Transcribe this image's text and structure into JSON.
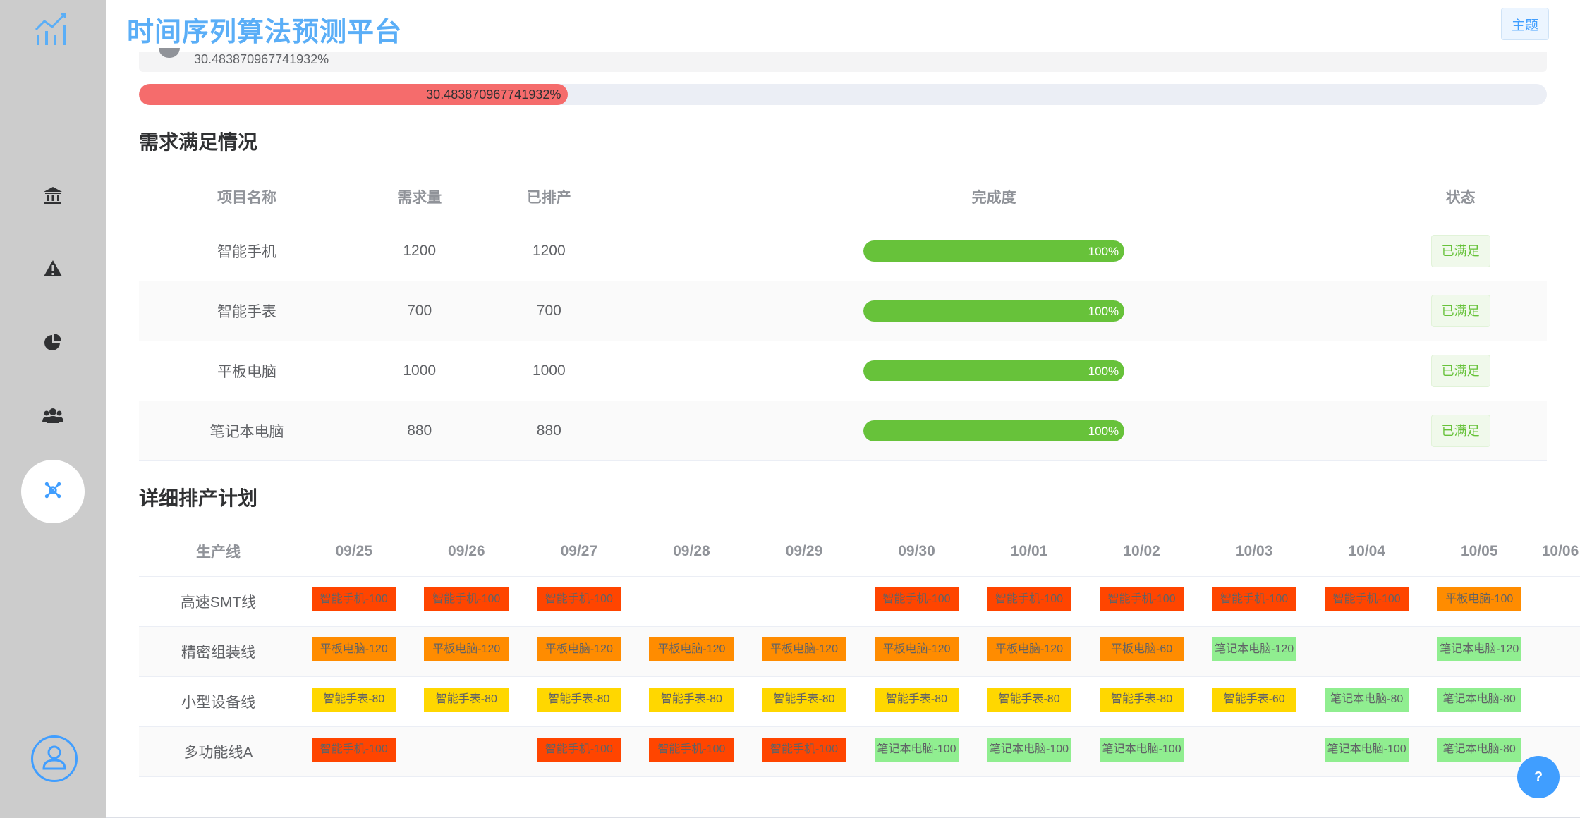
{
  "app": {
    "title": "时间序列算法预测平台",
    "theme_label": "主题"
  },
  "colors": {
    "accent": "#409eff",
    "title": "#5aaef7",
    "danger": "#f56c6c",
    "success": "#67c23a",
    "smartphone": "#ff4500",
    "tablet": "#ff8c00",
    "smartwatch": "#ffd700",
    "laptop": "#90ee90"
  },
  "sidebar": {
    "logo_icon": "chart-logo-icon",
    "items": [
      {
        "icon": "bank-icon"
      },
      {
        "icon": "warning-icon"
      },
      {
        "icon": "pie-chart-icon"
      },
      {
        "icon": "users-icon"
      },
      {
        "icon": "network-icon",
        "active": true
      }
    ],
    "avatar_icon": "user-icon"
  },
  "overall": {
    "info_text": "30.483870967741932%",
    "progress_label": "30.483870967741932%",
    "progress_fraction": 0.3048
  },
  "demand": {
    "title": "需求满足情况",
    "columns": [
      "项目名称",
      "需求量",
      "已排产",
      "完成度",
      "状态"
    ],
    "rows": [
      {
        "name": "智能手机",
        "demand": "1200",
        "scheduled": "1200",
        "completion_label": "100%",
        "completion": 1.0,
        "status": "已满足"
      },
      {
        "name": "智能手表",
        "demand": "700",
        "scheduled": "700",
        "completion_label": "100%",
        "completion": 1.0,
        "status": "已满足"
      },
      {
        "name": "平板电脑",
        "demand": "1000",
        "scheduled": "1000",
        "completion_label": "100%",
        "completion": 1.0,
        "status": "已满足"
      },
      {
        "name": "笔记本电脑",
        "demand": "880",
        "scheduled": "880",
        "completion_label": "100%",
        "completion": 1.0,
        "status": "已满足"
      }
    ]
  },
  "schedule": {
    "title": "详细排产计划",
    "line_header": "生产线",
    "dates": [
      "09/25",
      "09/26",
      "09/27",
      "09/28",
      "09/29",
      "09/30",
      "10/01",
      "10/02",
      "10/03",
      "10/04",
      "10/05",
      "10/06"
    ],
    "rows": [
      {
        "line": "高速SMT线",
        "cells": [
          {
            "text": "智能手机-100",
            "product": "smartphone"
          },
          {
            "text": "智能手机-100",
            "product": "smartphone"
          },
          {
            "text": "智能手机-100",
            "product": "smartphone"
          },
          null,
          null,
          {
            "text": "智能手机-100",
            "product": "smartphone"
          },
          {
            "text": "智能手机-100",
            "product": "smartphone"
          },
          {
            "text": "智能手机-100",
            "product": "smartphone"
          },
          {
            "text": "智能手机-100",
            "product": "smartphone"
          },
          {
            "text": "智能手机-100",
            "product": "smartphone"
          },
          {
            "text": "平板电脑-100",
            "product": "tablet"
          },
          null
        ]
      },
      {
        "line": "精密组装线",
        "cells": [
          {
            "text": "平板电脑-120",
            "product": "tablet"
          },
          {
            "text": "平板电脑-120",
            "product": "tablet"
          },
          {
            "text": "平板电脑-120",
            "product": "tablet"
          },
          {
            "text": "平板电脑-120",
            "product": "tablet"
          },
          {
            "text": "平板电脑-120",
            "product": "tablet"
          },
          {
            "text": "平板电脑-120",
            "product": "tablet"
          },
          {
            "text": "平板电脑-120",
            "product": "tablet"
          },
          {
            "text": "平板电脑-60",
            "product": "tablet"
          },
          {
            "text": "笔记本电脑-120",
            "product": "laptop"
          },
          null,
          {
            "text": "笔记本电脑-120",
            "product": "laptop"
          },
          null
        ]
      },
      {
        "line": "小型设备线",
        "cells": [
          {
            "text": "智能手表-80",
            "product": "smartwatch"
          },
          {
            "text": "智能手表-80",
            "product": "smartwatch"
          },
          {
            "text": "智能手表-80",
            "product": "smartwatch"
          },
          {
            "text": "智能手表-80",
            "product": "smartwatch"
          },
          {
            "text": "智能手表-80",
            "product": "smartwatch"
          },
          {
            "text": "智能手表-80",
            "product": "smartwatch"
          },
          {
            "text": "智能手表-80",
            "product": "smartwatch"
          },
          {
            "text": "智能手表-80",
            "product": "smartwatch"
          },
          {
            "text": "智能手表-60",
            "product": "smartwatch"
          },
          {
            "text": "笔记本电脑-80",
            "product": "laptop"
          },
          {
            "text": "笔记本电脑-80",
            "product": "laptop"
          },
          null
        ]
      },
      {
        "line": "多功能线A",
        "cells": [
          {
            "text": "智能手机-100",
            "product": "smartphone"
          },
          null,
          {
            "text": "智能手机-100",
            "product": "smartphone"
          },
          {
            "text": "智能手机-100",
            "product": "smartphone"
          },
          {
            "text": "智能手机-100",
            "product": "smartphone"
          },
          {
            "text": "笔记本电脑-100",
            "product": "laptop"
          },
          {
            "text": "笔记本电脑-100",
            "product": "laptop"
          },
          {
            "text": "笔记本电脑-100",
            "product": "laptop"
          },
          null,
          {
            "text": "笔记本电脑-100",
            "product": "laptop"
          },
          {
            "text": "笔记本电脑-80",
            "product": "laptop"
          },
          null
        ]
      }
    ]
  },
  "help": {
    "label": "?"
  }
}
